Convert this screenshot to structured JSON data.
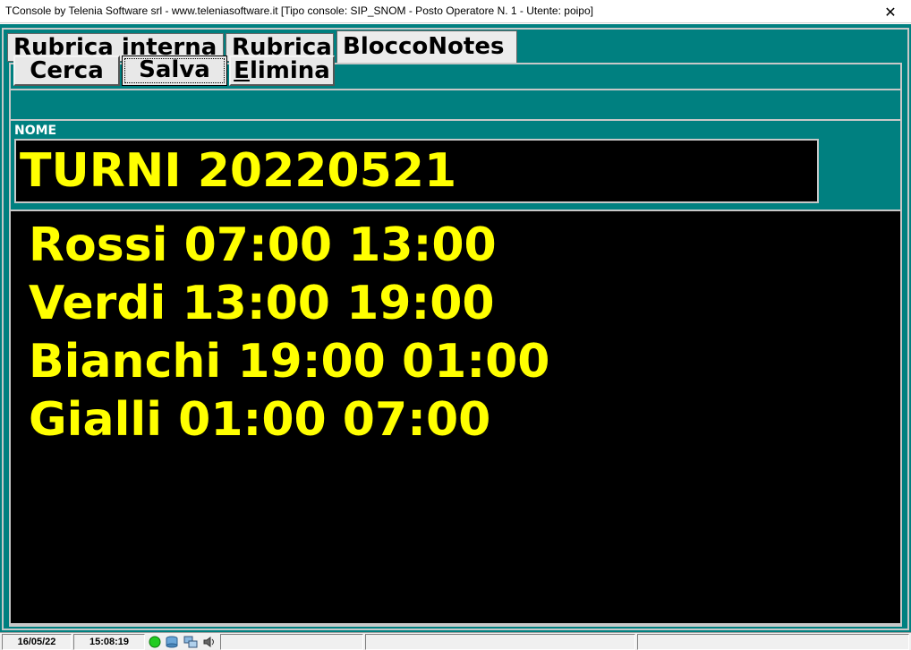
{
  "window": {
    "title": "TConsole by Telenia Software srl - www.teleniasoftware.it    [Tipo console: SIP_SNOM - Posto Operatore N. 1 - Utente: poipo]",
    "close_glyph": "✕"
  },
  "tabs": [
    {
      "label": "Rubrica interna",
      "active": false
    },
    {
      "label": "Rubrica",
      "active": false
    },
    {
      "label": "BloccoNotes",
      "active": true
    }
  ],
  "toolbar": {
    "cerca_label": "Cerca",
    "salva_label": "Salva",
    "elimina_accel": "E",
    "elimina_rest": "limina"
  },
  "note": {
    "name_label": "NOME",
    "name_value": "TURNI 20220521",
    "lines": [
      "Rossi 07:00 13:00",
      "Verdi 13:00 19:00",
      "Bianchi 19:00 01:00",
      "Gialli 01:00 07:00"
    ]
  },
  "statusbar": {
    "date": "16/05/22",
    "time": "15:08:19",
    "icons": [
      "status-online-icon",
      "database-icon",
      "network-icon",
      "speaker-icon"
    ]
  },
  "colors": {
    "background": "#008080",
    "text_highlight": "#ffff00",
    "field_background": "#000000"
  }
}
